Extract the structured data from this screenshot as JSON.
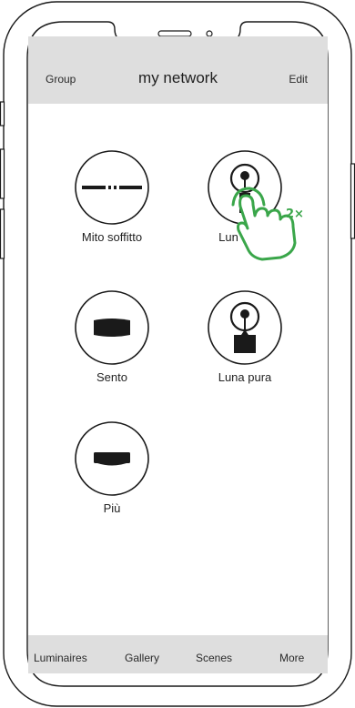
{
  "header": {
    "left_label": "Group",
    "title": "my network",
    "right_label": "Edit"
  },
  "luminaires": [
    {
      "label": "Mito soffitto",
      "icon": "ceiling-line-lamp-icon"
    },
    {
      "label": "Lun",
      "icon": "pendant-lamp-icon"
    },
    {
      "label": "Sento",
      "icon": "oval-lamp-icon"
    },
    {
      "label": "Luna pura",
      "icon": "pendant-lamp-icon"
    },
    {
      "label": "Più",
      "icon": "flat-lamp-icon"
    }
  ],
  "gesture": {
    "icon": "tap-hand-icon",
    "tap_count": "2×",
    "color": "#3aa64a"
  },
  "tabbar": {
    "items": [
      "Luminaires",
      "Gallery",
      "Scenes",
      "More"
    ]
  },
  "colors": {
    "bar_background": "#dedede",
    "accent": "#3aa64a",
    "ink": "#1a1a1a"
  }
}
